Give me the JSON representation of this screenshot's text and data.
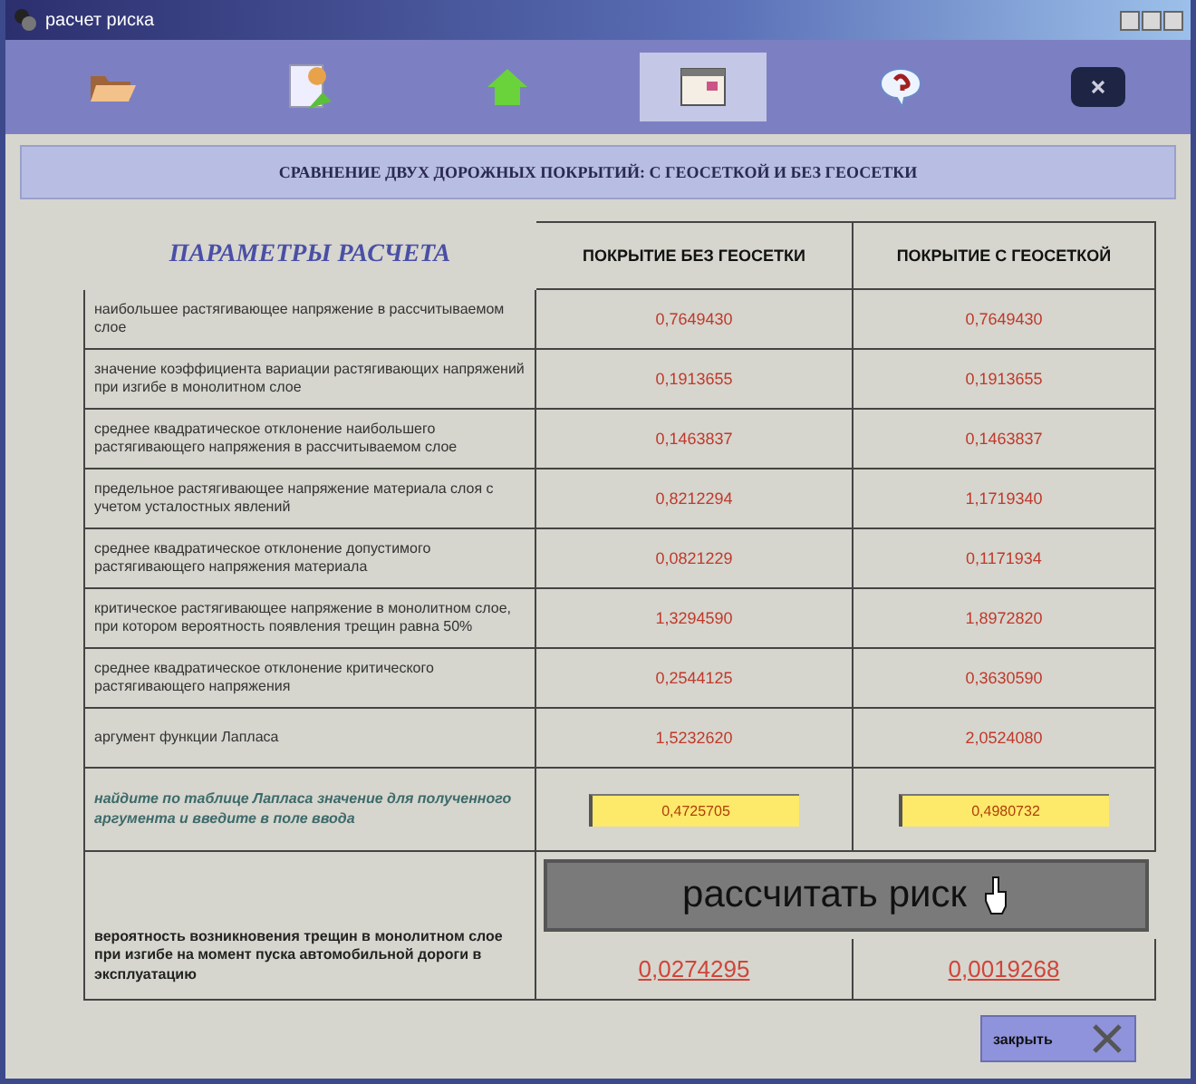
{
  "window": {
    "title": "расчет риска"
  },
  "toolbar": [
    {
      "kind": "folder",
      "selected": false
    },
    {
      "kind": "document",
      "selected": false
    },
    {
      "kind": "home",
      "selected": false
    },
    {
      "kind": "window",
      "selected": true
    },
    {
      "kind": "help",
      "selected": false
    },
    {
      "kind": "close",
      "selected": false
    }
  ],
  "heading": "СРАВНЕНИЕ ДВУХ ДОРОЖНЫХ ПОКРЫТИЙ: С ГЕОСЕТКОЙ И БЕЗ ГЕОСЕТКИ",
  "table": {
    "title": "ПАРАМЕТРЫ РАСЧЕТА",
    "columns": [
      "ПОКРЫТИЕ БЕЗ ГЕОСЕТКИ",
      "ПОКРЫТИЕ С ГЕОСЕТКОЙ"
    ],
    "rows": [
      {
        "label": "наибольшее растягивающее напряжение в рассчитываемом слое",
        "values": [
          "0,7649430",
          "0,7649430"
        ]
      },
      {
        "label": "значение коэффициента вариации растягивающих напряжений при изгибе в монолитном слое",
        "values": [
          "0,1913655",
          "0,1913655"
        ]
      },
      {
        "label": "среднее квадратическое отклонение наибольшего растягивающего напряжения в рассчитываемом слое",
        "values": [
          "0,1463837",
          "0,1463837"
        ]
      },
      {
        "label": "предельное растягивающее напряжение материала слоя с учетом усталостных явлений",
        "values": [
          "0,8212294",
          "1,1719340"
        ]
      },
      {
        "label": "среднее квадратическое отклонение допустимого растягивающего напряжения материала",
        "values": [
          "0,0821229",
          "0,1171934"
        ]
      },
      {
        "label": "критическое растягивающее напряжение в монолитном слое, при котором вероятность появления трещин равна 50%",
        "values": [
          "1,3294590",
          "1,8972820"
        ]
      },
      {
        "label": "среднее квадратическое отклонение критического растягивающего напряжения",
        "values": [
          "0,2544125",
          "0,3630590"
        ]
      },
      {
        "label": "аргумент функции Лапласа",
        "values": [
          "1,5232620",
          "2,0524080"
        ]
      }
    ],
    "input_row": {
      "label": "найдите по таблице Лапласа значение для полученного аргумента и введите в поле ввода",
      "values": [
        "0,4725705",
        "0,4980732"
      ]
    },
    "calculate_button": "рассчитать риск",
    "result_row": {
      "label": "вероятность возникновения трещин в монолитном слое при изгибе на момент пуска автомобильной дороги в эксплуатацию",
      "values": [
        "0,0274295",
        "0,0019268"
      ]
    }
  },
  "close_button": "закрыть"
}
